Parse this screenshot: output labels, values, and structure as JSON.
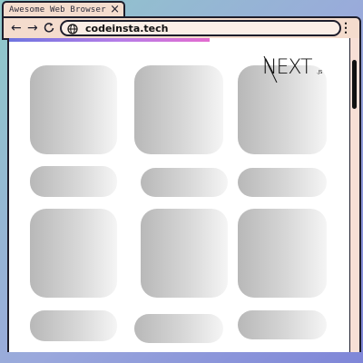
{
  "browser": {
    "tab_title": "Awesome Web Browser",
    "tab_close": "×",
    "back_icon": "arrow-left-icon",
    "forward_icon": "arrow-right-icon",
    "back_glyph": "←",
    "forward_glyph": "→",
    "address_icon": "globe-icon",
    "url": "codeinsta.tech",
    "menu_icon": "vertical-dots-icon",
    "menu_glyph": "⋮",
    "load_progress": 0.57
  },
  "page": {
    "logo": "NEXT.js",
    "logo_main": "NEXT",
    "logo_suffix": ".JS",
    "skeleton_rows": 4,
    "skeleton_columns": 3
  },
  "colors": {
    "frame_background": "#8fc9c9",
    "chrome": "#f4dccd",
    "border": "#1d1d2b",
    "progress_start": "#6e74e0",
    "progress_end": "#e36bcf",
    "skeleton_dark": "#b8b8b8",
    "skeleton_light": "#f5f5f5"
  }
}
